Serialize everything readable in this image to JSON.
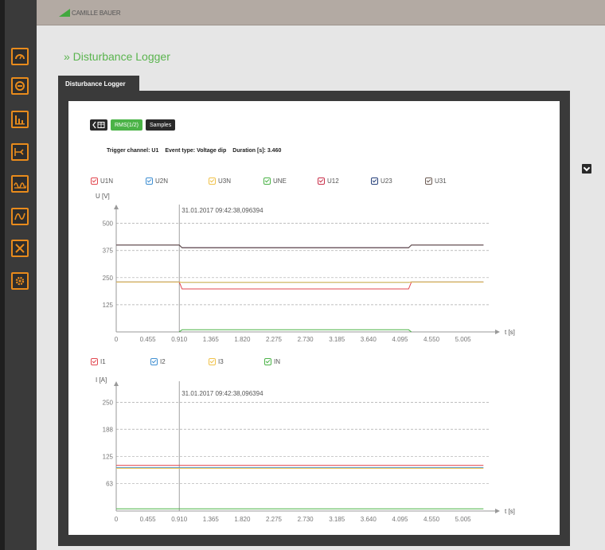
{
  "header": {
    "brand": "CAMILLE BAUER"
  },
  "page": {
    "title": "» Disturbance Logger",
    "tab_label": "Disturbance Logger"
  },
  "toolbar": {
    "rms_label": "RMS(1/2)",
    "samples_label": "Samples"
  },
  "info": {
    "trigger_label": "Trigger channel:",
    "trigger_value": "U1",
    "event_label": "Event type:",
    "event_value": "Voltage dip",
    "duration_label": "Duration [s]:",
    "duration_value": "3.460"
  },
  "colors": {
    "accent": "#4bb347",
    "sidebar_icon": "#e88b1c"
  },
  "sidebar": {
    "items": [
      "gauge-icon",
      "meter-icon",
      "bar-chart-icon",
      "flow-icon",
      "harmonics-icon",
      "waveform-icon",
      "tools-icon",
      "settings-icon"
    ]
  },
  "chart_data": [
    {
      "type": "line",
      "ylabel": "U [V]",
      "xlabel": "t [s]",
      "timestamp_label": "31.01.2017 09:42:38,096394",
      "x_ticks": [
        "0",
        "0.455",
        "0.910",
        "1.365",
        "1.820",
        "2.275",
        "2.730",
        "3.185",
        "3.640",
        "4.095",
        "4.550",
        "5.005"
      ],
      "y_ticks": [
        "125",
        "250",
        "375",
        "500"
      ],
      "ylim": [
        0,
        550
      ],
      "xlim": [
        0,
        5.4
      ],
      "trigger_x": 0.91,
      "legend": [
        {
          "name": "U1N",
          "color": "#e2474f"
        },
        {
          "name": "U2N",
          "color": "#3f8fd2"
        },
        {
          "name": "U3N",
          "color": "#f0c24a"
        },
        {
          "name": "UNE",
          "color": "#4bb347"
        },
        {
          "name": "U12",
          "color": "#c9304a"
        },
        {
          "name": "U23",
          "color": "#26407a"
        },
        {
          "name": "U31",
          "color": "#6b5a52"
        }
      ],
      "series": [
        {
          "name": "U12",
          "color": "#c9304a",
          "x": [
            0,
            0.91,
            0.95,
            4.22,
            4.26,
            5.3
          ],
          "y": [
            400,
            400,
            388,
            388,
            400,
            400
          ]
        },
        {
          "name": "U23",
          "color": "#26407a",
          "x": [
            0,
            0.91,
            0.95,
            4.22,
            4.26,
            5.3
          ],
          "y": [
            400,
            400,
            388,
            388,
            400,
            400
          ]
        },
        {
          "name": "U31",
          "color": "#6b5a52",
          "x": [
            0,
            0.91,
            0.95,
            4.22,
            4.26,
            5.3
          ],
          "y": [
            400,
            400,
            388,
            388,
            400,
            400
          ]
        },
        {
          "name": "U1N",
          "color": "#e2474f",
          "x": [
            0,
            0.91,
            0.95,
            4.22,
            4.26,
            5.3
          ],
          "y": [
            230,
            230,
            198,
            198,
            230,
            230
          ]
        },
        {
          "name": "U2N",
          "color": "#3f8fd2",
          "x": [
            0,
            0.91,
            0.95,
            4.22,
            4.26,
            5.3
          ],
          "y": [
            230,
            230,
            228,
            228,
            230,
            230
          ]
        },
        {
          "name": "U3N",
          "color": "#f0c24a",
          "x": [
            0,
            0.91,
            0.95,
            4.22,
            4.26,
            5.3
          ],
          "y": [
            230,
            230,
            228,
            228,
            230,
            230
          ]
        },
        {
          "name": "UNE",
          "color": "#4bb347",
          "x": [
            0.91,
            0.95,
            4.22,
            4.26
          ],
          "y": [
            0,
            10,
            10,
            0
          ]
        }
      ]
    },
    {
      "type": "line",
      "ylabel": "I [A]",
      "xlabel": "t [s]",
      "timestamp_label": "31.01.2017 09:42:38,096394",
      "x_ticks": [
        "0",
        "0.455",
        "0.910",
        "1.365",
        "1.820",
        "2.275",
        "2.730",
        "3.185",
        "3.640",
        "4.095",
        "4.550",
        "5.005"
      ],
      "y_ticks": [
        "63",
        "125",
        "188",
        "250"
      ],
      "ylim": [
        0,
        280
      ],
      "xlim": [
        0,
        5.4
      ],
      "trigger_x": 0.91,
      "legend": [
        {
          "name": "I1",
          "color": "#e2474f"
        },
        {
          "name": "I2",
          "color": "#3f8fd2"
        },
        {
          "name": "I3",
          "color": "#f0c24a"
        },
        {
          "name": "IN",
          "color": "#4bb347"
        }
      ],
      "series": [
        {
          "name": "I1",
          "color": "#e2474f",
          "x": [
            0,
            5.3
          ],
          "y": [
            105,
            105
          ]
        },
        {
          "name": "I2",
          "color": "#3f8fd2",
          "x": [
            0,
            5.3
          ],
          "y": [
            100,
            100
          ]
        },
        {
          "name": "I3",
          "color": "#f0c24a",
          "x": [
            0,
            5.3
          ],
          "y": [
            98,
            98
          ]
        },
        {
          "name": "IN",
          "color": "#4bb347",
          "x": [
            0,
            5.3
          ],
          "y": [
            5,
            5
          ]
        }
      ]
    }
  ]
}
